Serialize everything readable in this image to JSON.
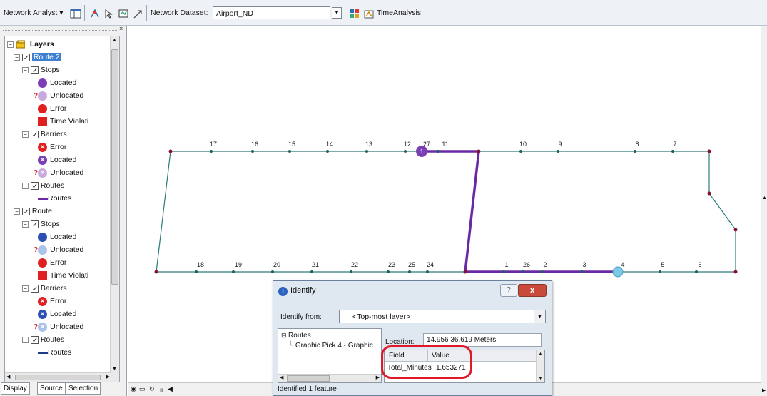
{
  "toolbar": {
    "network_analyst_label": "Network Analyst ▾",
    "network_dataset_label": "Network Dataset:",
    "network_dataset_value": "Airport_ND",
    "time_analysis_label": "TimeAnalysis"
  },
  "toc": {
    "root_label": "Layers",
    "rows": [
      {
        "label": "Route 2",
        "selected": true
      },
      {
        "label": "Stops"
      },
      {
        "label": "Located"
      },
      {
        "label": "Unlocated"
      },
      {
        "label": "Error"
      },
      {
        "label": "Time Violati"
      },
      {
        "label": "Barriers"
      },
      {
        "label": "Error"
      },
      {
        "label": "Located"
      },
      {
        "label": "Unlocated"
      },
      {
        "label": "Routes"
      },
      {
        "label": "Routes"
      },
      {
        "label": "Route"
      },
      {
        "label": "Stops"
      },
      {
        "label": "Located"
      },
      {
        "label": "Unlocated"
      },
      {
        "label": "Error"
      },
      {
        "label": "Time Violati"
      },
      {
        "label": "Barriers"
      },
      {
        "label": "Error"
      },
      {
        "label": "Located"
      },
      {
        "label": "Unlocated"
      },
      {
        "label": "Routes"
      },
      {
        "label": "Routes"
      }
    ],
    "tabs": [
      "Display",
      "Source",
      "Selection"
    ]
  },
  "map": {
    "top_labels": [
      "17",
      "16",
      "15",
      "14",
      "13",
      "12",
      "27",
      "11",
      "10",
      "9",
      "8",
      "7"
    ],
    "bottom_labels": [
      "18",
      "19",
      "20",
      "21",
      "22",
      "23",
      "25",
      "24",
      "1",
      "26",
      "2",
      "3",
      "4",
      "5",
      "6"
    ],
    "stop_1_label": "1",
    "route_color": "#6a2aa6",
    "network_color": "#2d7a7a"
  },
  "identify": {
    "title": "Identify",
    "help": "?",
    "close": "x",
    "identify_from_label": "Identify from:",
    "identify_from_value": "<Top-most layer>",
    "tree_root": "Routes",
    "tree_child": "Graphic Pick 4 - Graphic",
    "location_label": "Location:",
    "location_value": "14.956  36.619 Meters",
    "grid_headers": [
      "Field",
      "Value"
    ],
    "field_name": "Total_Minutes",
    "field_value": "1.653271",
    "status": "Identified 1 feature"
  }
}
